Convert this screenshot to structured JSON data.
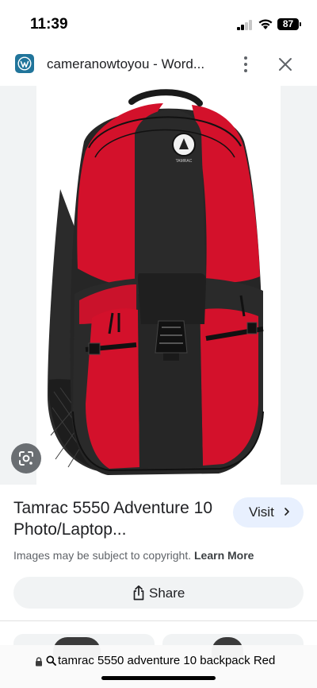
{
  "status_bar": {
    "time": "11:39",
    "battery": "87",
    "signal_icon": "cellular-signal-icon",
    "wifi_icon": "wifi-icon"
  },
  "header": {
    "site_icon": "wordpress-icon",
    "title": "cameranowtoyou - Word...",
    "more_icon": "more-vert-icon",
    "close_icon": "close-icon"
  },
  "image": {
    "subject": "red-and-black-backpack",
    "lens_icon": "google-lens-icon",
    "brand_mark": "tamrac"
  },
  "result": {
    "title": "Tamrac 5550 Adventure 10 Photo/Laptop...",
    "visit_label": "Visit",
    "copyright_text": "Images may be subject to copyright.",
    "learn_more_label": "Learn More",
    "share_label": "Share"
  },
  "url_bar": {
    "text": "tamrac 5550 adventure 10 backpack Red"
  },
  "colors": {
    "backpack_red": "#d3112b",
    "backpack_black": "#2a2a2a",
    "visit_bg": "#e8f0fe",
    "wordpress_blue": "#21759b"
  }
}
